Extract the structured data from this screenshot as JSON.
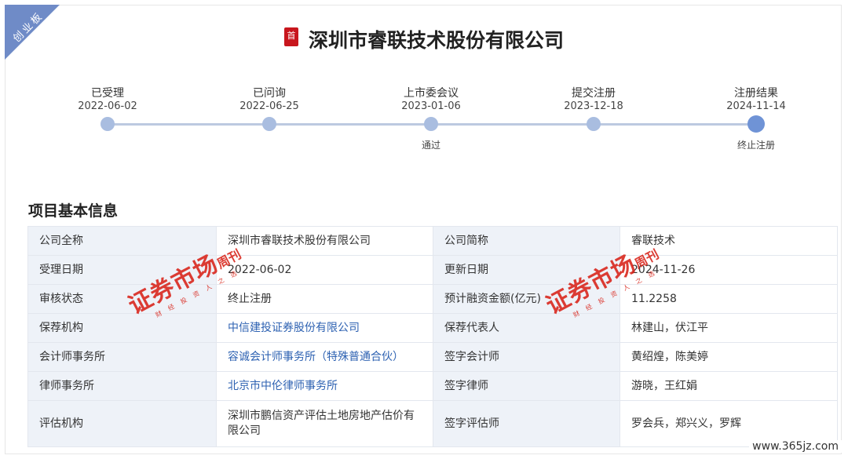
{
  "board_badge": "创业板",
  "title_badge": "首",
  "company_title": "深圳市睿联技术股份有限公司",
  "timeline": [
    {
      "label": "已受理",
      "date": "2022-06-02",
      "sub": ""
    },
    {
      "label": "已问询",
      "date": "2022-06-25",
      "sub": ""
    },
    {
      "label": "上市委会议",
      "date": "2023-01-06",
      "sub": "通过"
    },
    {
      "label": "提交注册",
      "date": "2023-12-18",
      "sub": ""
    },
    {
      "label": "注册结果",
      "date": "2024-11-14",
      "sub": "终止注册"
    }
  ],
  "section_title": "项目基本信息",
  "info": {
    "r0": {
      "k1": "公司全称",
      "v1": "深圳市睿联技术股份有限公司",
      "k2": "公司简称",
      "v2": "睿联技术"
    },
    "r1": {
      "k1": "受理日期",
      "v1": "2022-06-02",
      "k2": "更新日期",
      "v2": "2024-11-26"
    },
    "r2": {
      "k1": "审核状态",
      "v1": "终止注册",
      "k2": "预计融资金额(亿元)",
      "v2": "11.2258"
    },
    "r3": {
      "k1": "保荐机构",
      "v1": "中信建投证券股份有限公司",
      "k2": "保荐代表人",
      "v2": "林建山，伏江平"
    },
    "r4": {
      "k1": "会计师事务所",
      "v1": "容诚会计师事务所（特殊普通合伙）",
      "k2": "签字会计师",
      "v2": "黄绍煌，陈美婷"
    },
    "r5": {
      "k1": "律师事务所",
      "v1": "北京市中伦律师事务所",
      "k2": "签字律师",
      "v2": "游晓，王红娟"
    },
    "r6": {
      "k1": "评估机构",
      "v1": "深圳市鹏信资产评估土地房地产估价有限公司",
      "k2": "签字评估师",
      "v2": "罗会兵，郑兴义，罗辉"
    }
  },
  "watermark": {
    "main": "证券市场",
    "side": "周刊",
    "tagline": "财经投资人之选"
  },
  "footer_url": "www.365jz.com"
}
